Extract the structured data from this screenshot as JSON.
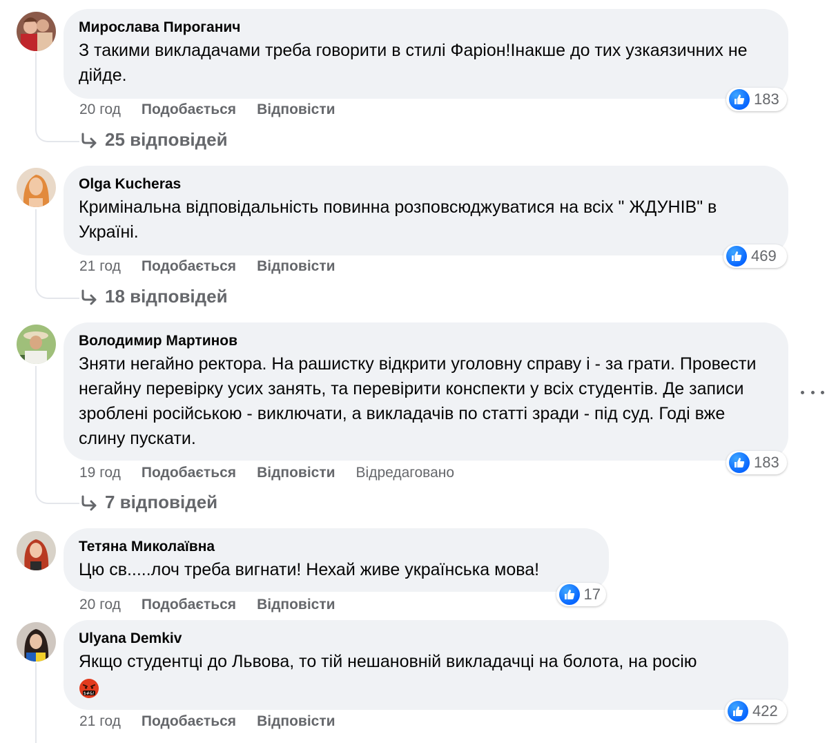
{
  "accent_color": "#0866ff",
  "comments": [
    {
      "author": "Мирослава Пироганич",
      "text": "З такими викладачами треба говорити в стилі Фаріон!Інакше до тих узкаязичних не дійде.",
      "time": "20 год",
      "like_label": "Подобається",
      "reply_label": "Відповісти",
      "reactions": "183",
      "replies": "25 відповідей"
    },
    {
      "author": "Olga Kucheras",
      "text": "Кримінальна відповідальність повинна розповсюджуватися на всіх \" ЖДУНІВ\" в Україні.",
      "time": "21 год",
      "like_label": "Подобається",
      "reply_label": "Відповісти",
      "reactions": "469",
      "replies": "18 відповідей"
    },
    {
      "author": "Володимир Мартинов",
      "text": "Зняти негайно ректора. На рашистку відкрити уголовну справу і - за грати. Провести негайну перевірку усих занять, та перевірити конспекти у всіх студентів. Де записи зроблені російською - виключати, а викладачів по статті зради - під суд. Годі вже слину пускати.",
      "time": "19 год",
      "like_label": "Подобається",
      "reply_label": "Відповісти",
      "edited_label": "Відредаговано",
      "reactions": "183",
      "replies": "7 відповідей"
    },
    {
      "author": "Тетяна Миколаївна",
      "text": "Цю св.....лоч треба вигнати! Нехай живе українська мова!",
      "time": "20 год",
      "like_label": "Подобається",
      "reply_label": "Відповісти",
      "reactions": "17"
    },
    {
      "author": "Ulyana Demkiv",
      "text": "Якщо студентці до Львова, то тій нешановній викладачці на болота, на росію",
      "emoji": "face-with-symbols-on-mouth",
      "time": "21 год",
      "like_label": "Подобається",
      "reply_label": "Відповісти",
      "reactions": "422"
    }
  ]
}
